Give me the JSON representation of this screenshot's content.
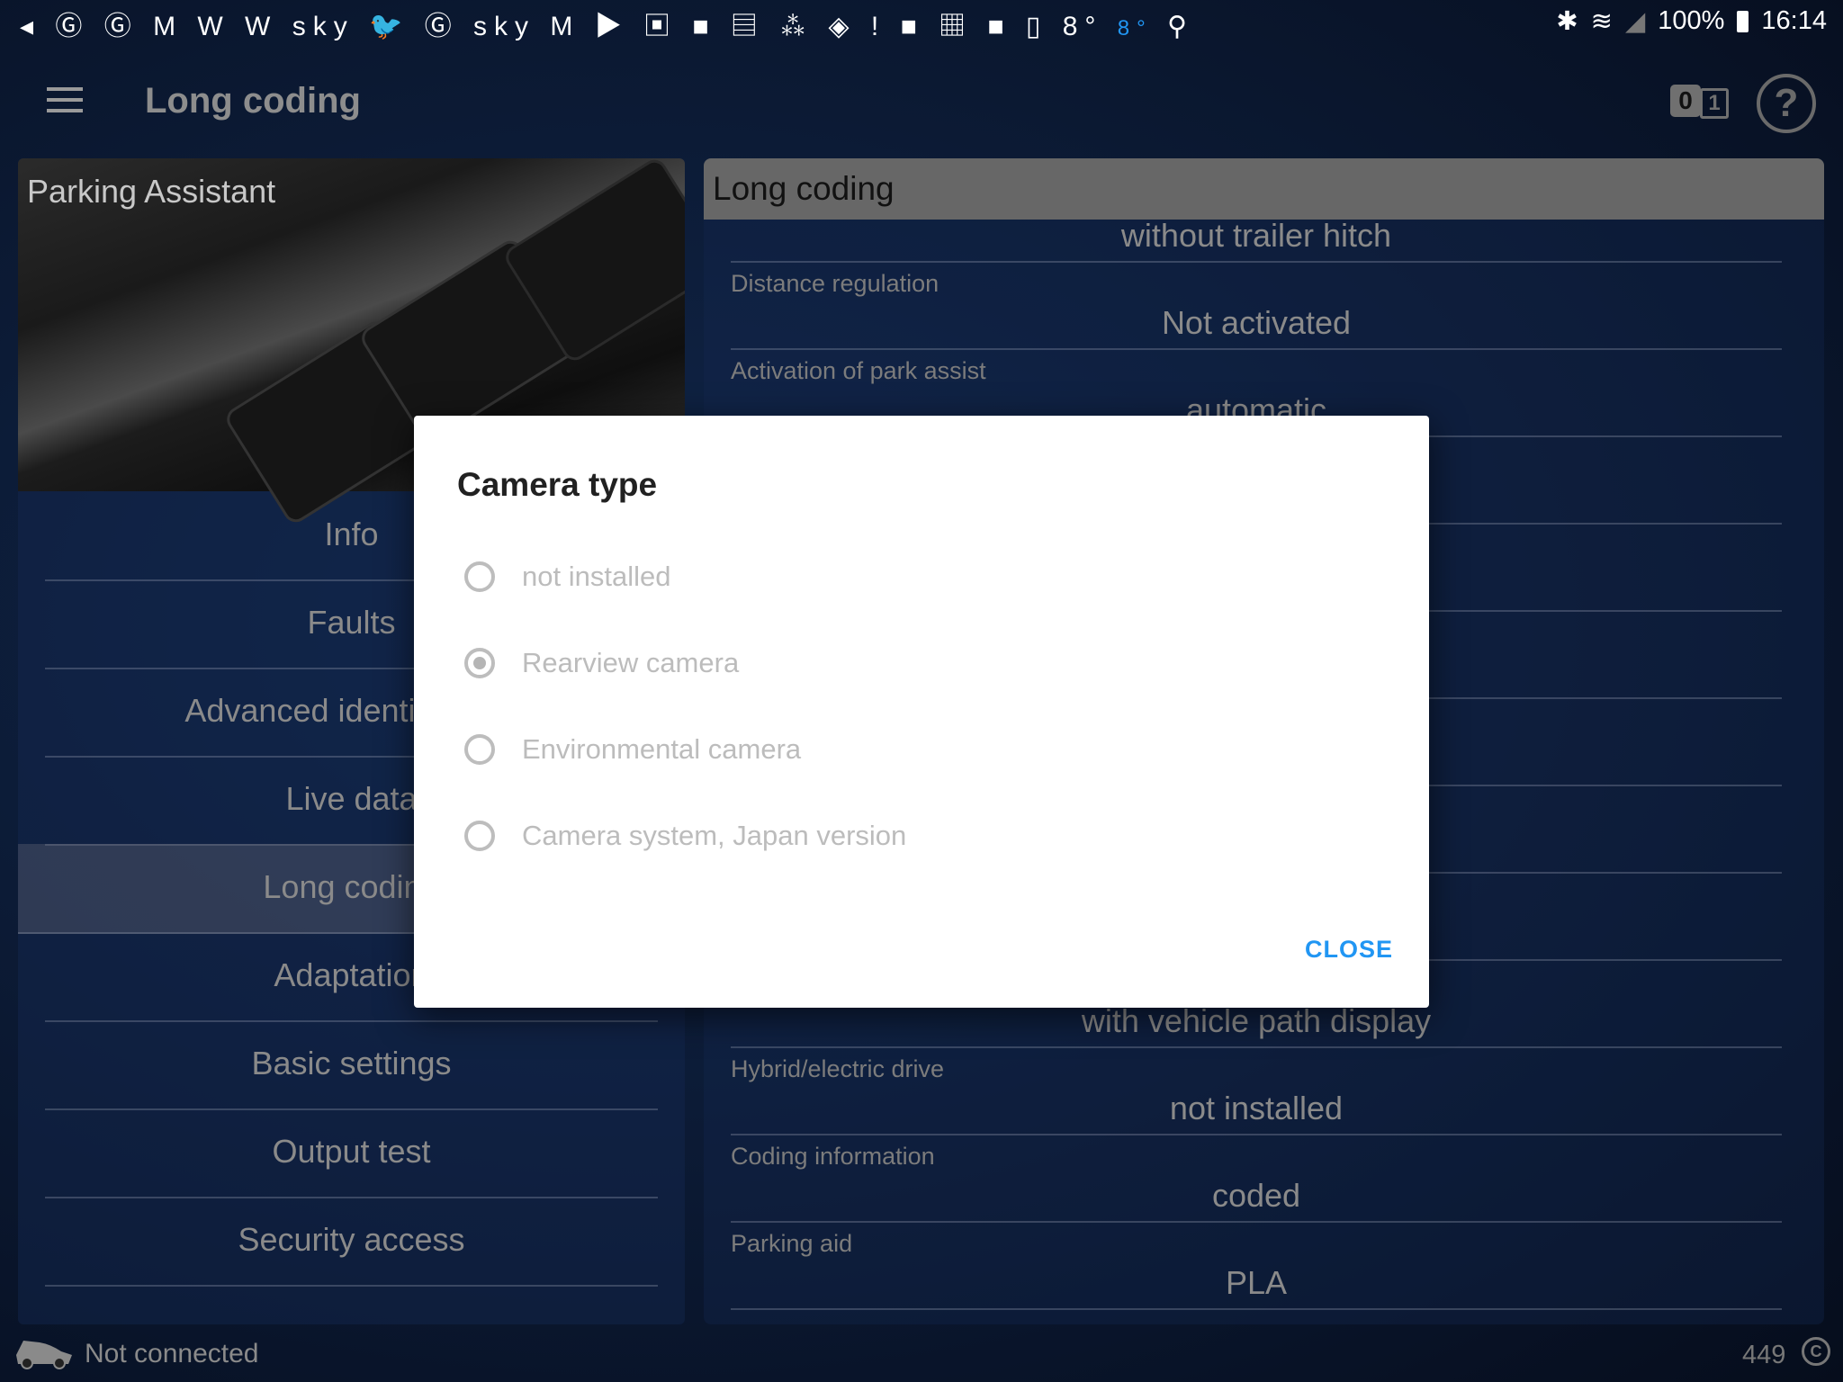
{
  "status_bar": {
    "notification_icons": [
      "volume-icon",
      "guardian-icon",
      "guardian-icon",
      "gmail-icon",
      "w-icon",
      "w-icon",
      "sky-news-icon",
      "twitter-icon",
      "guardian-icon",
      "sky-news-icon",
      "gmail-icon",
      "youtube-icon",
      "gallery-icon",
      "flipboard-icon",
      "news-icon",
      "cluster-icon",
      "nyt-icon",
      "alert-icon",
      "flipboard-icon",
      "bbc-news-icon",
      "flipboard-icon",
      "d-icon",
      "weather-icon",
      "location-icon"
    ],
    "left_text": "◂ Ⓖ Ⓖ M W W sky 🐦 Ⓖ sky M ▶ ▣ ■ ▤ ⁂ ◈ ! ■ ▦ ■ ▯",
    "temp_white": "8°",
    "temp_blue": "8°",
    "temp_blue_color": "#2196f3",
    "battery": "100%",
    "time": "16:14"
  },
  "app_bar": {
    "title": "Long coding",
    "obd_left": "0",
    "obd_right": "1",
    "help": "?"
  },
  "left_panel": {
    "title": "Parking Assistant",
    "menu": [
      {
        "label": "Info"
      },
      {
        "label": "Faults"
      },
      {
        "label": "Advanced identification"
      },
      {
        "label": "Live data"
      },
      {
        "label": "Long coding",
        "active": true
      },
      {
        "label": "Adaptation"
      },
      {
        "label": "Basic settings"
      },
      {
        "label": "Output test"
      },
      {
        "label": "Security access"
      }
    ]
  },
  "right_panel": {
    "title": "Long coding",
    "rows": [
      {
        "label": "",
        "value": "without trailer hitch"
      },
      {
        "label": "Distance regulation",
        "value": "Not activated"
      },
      {
        "label": "Activation of park assist",
        "value": "automatic"
      },
      {
        "label": "",
        "value": ""
      },
      {
        "label": "",
        "value": ""
      },
      {
        "label": "",
        "value": ""
      },
      {
        "label": "",
        "value": ""
      },
      {
        "label": "",
        "value": ""
      },
      {
        "label": "",
        "value": ""
      },
      {
        "label": "",
        "value": "with vehicle path display"
      },
      {
        "label": "Hybrid/electric drive",
        "value": "not installed"
      },
      {
        "label": "Coding information",
        "value": "coded"
      },
      {
        "label": "Parking aid",
        "value": "PLA"
      },
      {
        "label": "",
        "value": ""
      }
    ]
  },
  "dialog": {
    "title": "Camera type",
    "options": [
      {
        "label": "not installed",
        "selected": false
      },
      {
        "label": "Rearview camera",
        "selected": true
      },
      {
        "label": "Environmental camera",
        "selected": false
      },
      {
        "label": "Camera system, Japan version",
        "selected": false
      }
    ],
    "close_label": "CLOSE",
    "accent": "#2196f3"
  },
  "footer": {
    "connection": "Not connected",
    "count": "449"
  }
}
